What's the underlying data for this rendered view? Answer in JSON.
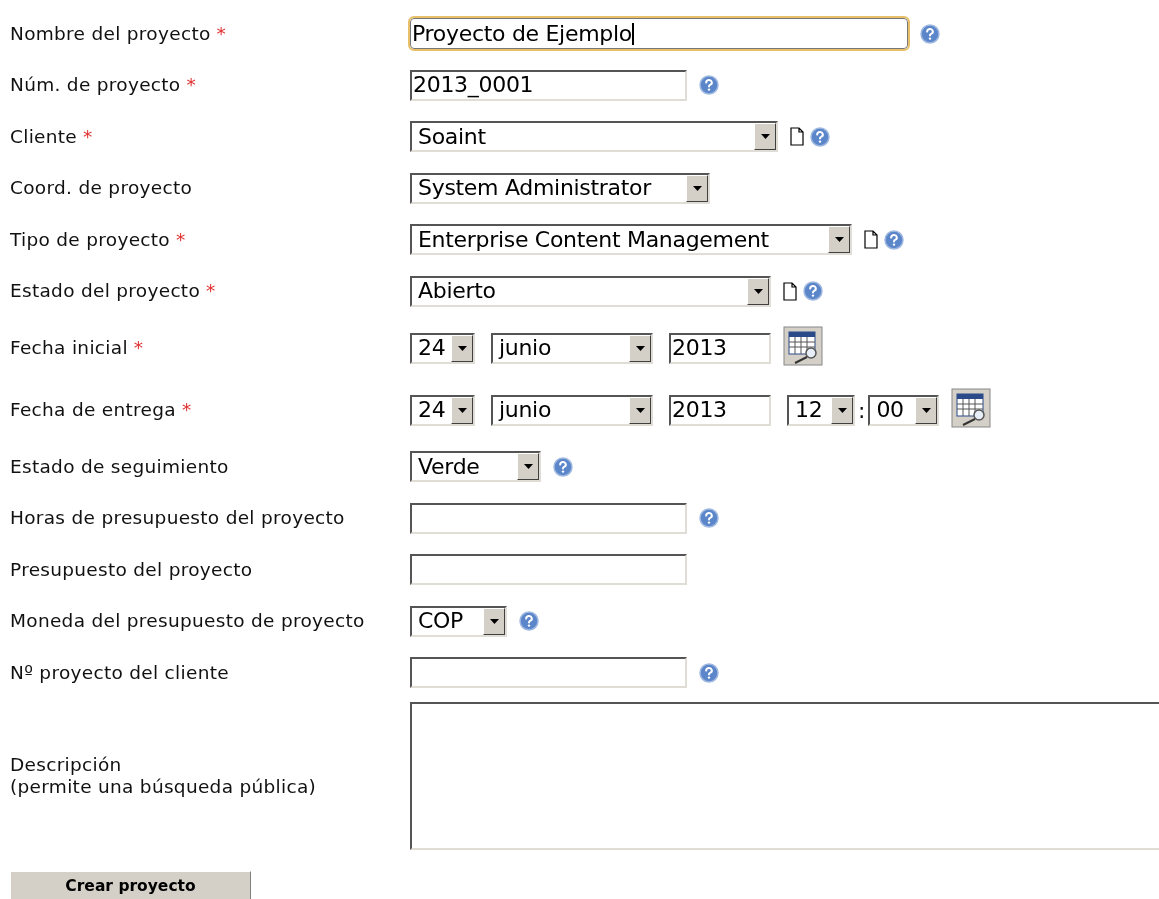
{
  "rows": [
    {
      "label": "Nombre del proyecto",
      "required_mark": "*",
      "controls": [
        {
          "kind": "text",
          "value": "Proyecto de Ejemplo",
          "focused": true
        }
      ],
      "extras": [
        {
          "kind": "help"
        }
      ]
    },
    {
      "label": "Núm. de proyecto",
      "required_mark": "*",
      "controls": [
        {
          "kind": "text",
          "value": "2013_0001",
          "focused": false
        }
      ],
      "extras": [
        {
          "kind": "help"
        }
      ]
    },
    {
      "label": "Cliente",
      "required_mark": "*",
      "controls": [
        {
          "kind": "select",
          "value": "Soaint"
        }
      ],
      "extras": [
        {
          "kind": "new"
        },
        {
          "kind": "help"
        }
      ]
    },
    {
      "label": "Coord. de proyecto",
      "controls": [
        {
          "kind": "select",
          "value": "System Administrator"
        }
      ],
      "extras": []
    },
    {
      "label": "Tipo de proyecto",
      "required_mark": "*",
      "controls": [
        {
          "kind": "select",
          "value": "Enterprise Content Management"
        }
      ],
      "extras": [
        {
          "kind": "new"
        },
        {
          "kind": "help"
        }
      ]
    },
    {
      "label": "Estado del proyecto",
      "required_mark": "*",
      "controls": [
        {
          "kind": "select",
          "value": "Abierto"
        }
      ],
      "extras": [
        {
          "kind": "new"
        },
        {
          "kind": "help"
        }
      ]
    },
    {
      "label": "Fecha inicial",
      "required_mark": "*",
      "controls": [
        {
          "kind": "select",
          "value": "24"
        },
        {
          "kind": "select",
          "value": "junio"
        },
        {
          "kind": "text",
          "value": "2013",
          "focused": false
        }
      ],
      "extras": [
        {
          "kind": "calendar"
        }
      ]
    },
    {
      "label": "Fecha de entrega",
      "required_mark": "*",
      "controls": [
        {
          "kind": "select",
          "value": "24"
        },
        {
          "kind": "select",
          "value": "junio"
        },
        {
          "kind": "text",
          "value": "2013",
          "focused": false
        },
        {
          "kind": "select",
          "value": "12"
        },
        {
          "kind": "separator",
          "value": ":"
        },
        {
          "kind": "select",
          "value": "00"
        }
      ],
      "extras": [
        {
          "kind": "calendar"
        }
      ]
    },
    {
      "label": "Estado de seguimiento",
      "controls": [
        {
          "kind": "select",
          "value": "Verde"
        }
      ],
      "extras": [
        {
          "kind": "help"
        }
      ]
    },
    {
      "label": "Horas de presupuesto del proyecto",
      "controls": [
        {
          "kind": "text",
          "focused": false
        }
      ],
      "extras": [
        {
          "kind": "help"
        }
      ]
    },
    {
      "label": "Presupuesto del proyecto",
      "controls": [
        {
          "kind": "text",
          "focused": false
        }
      ],
      "extras": []
    },
    {
      "label": "Moneda del presupuesto de proyecto",
      "controls": [
        {
          "kind": "select",
          "value": "COP"
        }
      ],
      "extras": [
        {
          "kind": "help"
        }
      ]
    },
    {
      "label": "Nº proyecto del cliente",
      "controls": [
        {
          "kind": "text",
          "focused": false
        }
      ],
      "extras": [
        {
          "kind": "help"
        }
      ]
    },
    {
      "label": "Descripción\n(permite una búsqueda pública)",
      "controls": [
        {
          "kind": "textarea"
        }
      ],
      "extras": []
    }
  ],
  "submit": "Crear proyecto"
}
